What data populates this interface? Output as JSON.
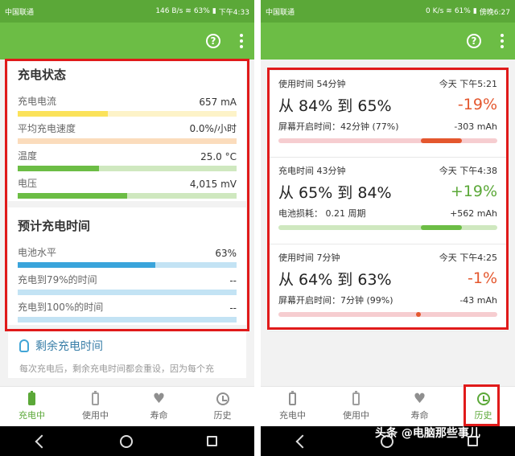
{
  "left": {
    "status_bar": {
      "carrier": "中国联通",
      "speed": "146 B/s",
      "battery": "63%",
      "time": "下午4:33"
    },
    "charge_status": {
      "title": "充电状态",
      "metrics": [
        {
          "label": "充电电流",
          "value": "657 mA",
          "fill": 0.41,
          "color": "#fbe25a",
          "track": "#fdf3c8"
        },
        {
          "label": "平均充电速度",
          "value": "0.0%/小时",
          "fill": 0.0,
          "color": "#f7b267",
          "track": "#fbdcbc"
        },
        {
          "label": "温度",
          "value": "25.0 °C",
          "fill": 0.37,
          "color": "#6cbd45",
          "track": "#cfe8bf"
        },
        {
          "label": "电压",
          "value": "4,015 mV",
          "fill": 0.5,
          "color": "#6cbd45",
          "track": "#cfe8bf"
        }
      ]
    },
    "estimated_time": {
      "title": "预计充电时间",
      "metrics": [
        {
          "label": "电池水平",
          "value": "63%",
          "fill": 0.63,
          "color": "#3aa4db",
          "track": "#c3e3f4"
        },
        {
          "label": "充电到79%的时间",
          "value": "--",
          "fill": 0.0,
          "color": "#3aa4db",
          "track": "#c3e3f4"
        },
        {
          "label": "充电到100%的时间",
          "value": "--",
          "fill": 0.0,
          "color": "#3aa4db",
          "track": "#c3e3f4"
        }
      ]
    },
    "tip": {
      "title": "剩余充电时间",
      "text": "每次充电后，剩余充电时间都会重设，因为每个充"
    },
    "nav": [
      {
        "label": "充电中",
        "active": true
      },
      {
        "label": "使用中",
        "active": false
      },
      {
        "label": "寿命",
        "active": false
      },
      {
        "label": "历史",
        "active": false
      }
    ]
  },
  "right": {
    "status_bar": {
      "carrier": "中国联通",
      "speed": "0 K/s",
      "battery": "61%",
      "time": "傍晚6:27"
    },
    "history": [
      {
        "duration": "使用时间 54分钟",
        "time": "今天 下午5:21",
        "range": "从 84% 到 65%",
        "delta": "-19%",
        "delta_color": "#e4572e",
        "detail": "屏幕开启时间：42分钟 (77%)",
        "mah": "-303 mAh",
        "track": "#f6cdd0",
        "seg_start": 0.65,
        "seg_end": 0.84,
        "seg_color": "#e4572e"
      },
      {
        "duration": "充电时间 43分钟",
        "time": "今天 下午4:38",
        "range": "从 65% 到 84%",
        "delta": "+19%",
        "delta_color": "#5ba838",
        "detail": "电池损耗： 0.21 周期",
        "mah": "+562 mAh",
        "track": "#cfe8bf",
        "seg_start": 0.65,
        "seg_end": 0.84,
        "seg_color": "#6cbd45"
      },
      {
        "duration": "使用时间 7分钟",
        "time": "今天 下午4:25",
        "range": "从 64% 到 63%",
        "delta": "-1%",
        "delta_color": "#e4572e",
        "detail": "屏幕开启时间：7分钟 (99%)",
        "mah": "-43 mAh",
        "track": "#f6cdd0",
        "seg_start": 0.63,
        "seg_end": 0.64,
        "seg_color": "#e4572e"
      }
    ],
    "nav": [
      {
        "label": "充电中",
        "active": false
      },
      {
        "label": "使用中",
        "active": false
      },
      {
        "label": "寿命",
        "active": false
      },
      {
        "label": "历史",
        "active": true
      }
    ]
  },
  "watermark": "头条 @电脑那些事儿"
}
